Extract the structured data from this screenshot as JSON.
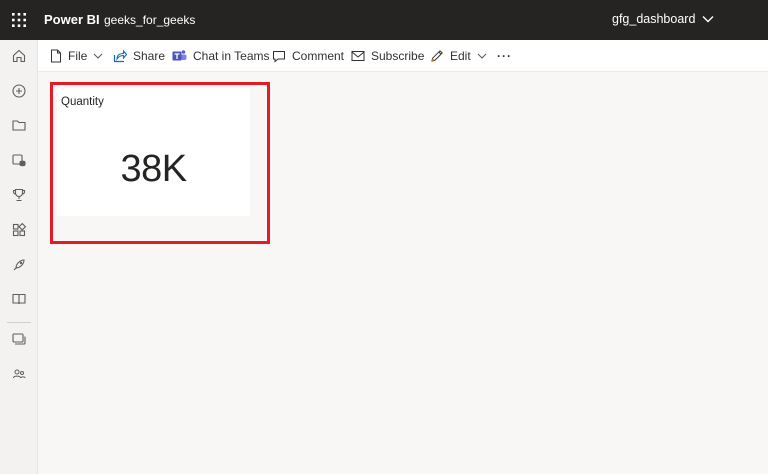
{
  "topbar": {
    "app_name": "Power BI",
    "workspace": "geeks_for_geeks",
    "report_name": "gfg_dashboard"
  },
  "leftnav": {
    "items": [
      {
        "icon": "home-icon"
      },
      {
        "icon": "create-icon"
      },
      {
        "icon": "browse-icon"
      },
      {
        "icon": "data-hub-icon"
      },
      {
        "icon": "goals-icon"
      },
      {
        "icon": "apps-icon"
      },
      {
        "icon": "learn-icon"
      },
      {
        "icon": "workspaces-icon"
      },
      {
        "icon": "my-workspace-icon"
      },
      {
        "icon": "people-icon"
      }
    ]
  },
  "toolbar": {
    "file_label": "File",
    "share_label": "Share",
    "chat_label": "Chat in Teams",
    "comment_label": "Comment",
    "subscribe_label": "Subscribe",
    "edit_label": "Edit",
    "more_label": "···"
  },
  "card": {
    "title": "Quantity",
    "value": "38K"
  },
  "colors": {
    "topbar_bg": "#252423",
    "highlight": "#e31b23",
    "canvas_bg": "#f8f7f5"
  }
}
